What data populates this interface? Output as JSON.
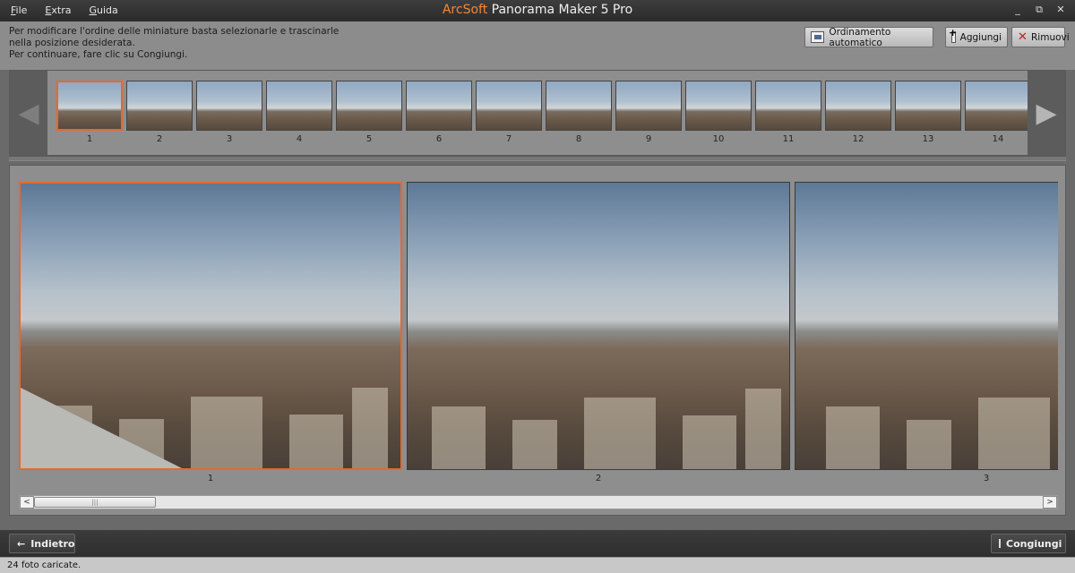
{
  "menu": [
    "File",
    "Extra",
    "Guida"
  ],
  "title": {
    "brand": "ArcSoft",
    "rest": "Panorama Maker 5 Pro"
  },
  "window": {
    "minimize": "_",
    "restore": "⧉",
    "close": "✕"
  },
  "instructions": {
    "line1": "Per modificare l'ordine delle miniature basta selezionarle e trascinarle nella posizione desiderata.",
    "line2": "Per continuare, fare clic su Congiungi."
  },
  "toolbar": {
    "auto_sort": "Ordinamento automatico",
    "add": "Aggiungi",
    "remove": "Rimuovi"
  },
  "thumbnails": [
    "1",
    "2",
    "3",
    "4",
    "5",
    "6",
    "7",
    "8",
    "9",
    "10",
    "11",
    "12",
    "13",
    "14"
  ],
  "frames": [
    "1",
    "2",
    "3"
  ],
  "scroll": {
    "left": "<",
    "right": ">",
    "grip": "|||"
  },
  "bottom": {
    "back": "Indietro",
    "join": "Congiungi"
  },
  "status": "24 foto caricate.",
  "colors": {
    "selection": "#e8682a",
    "brand": "#f0883a"
  }
}
